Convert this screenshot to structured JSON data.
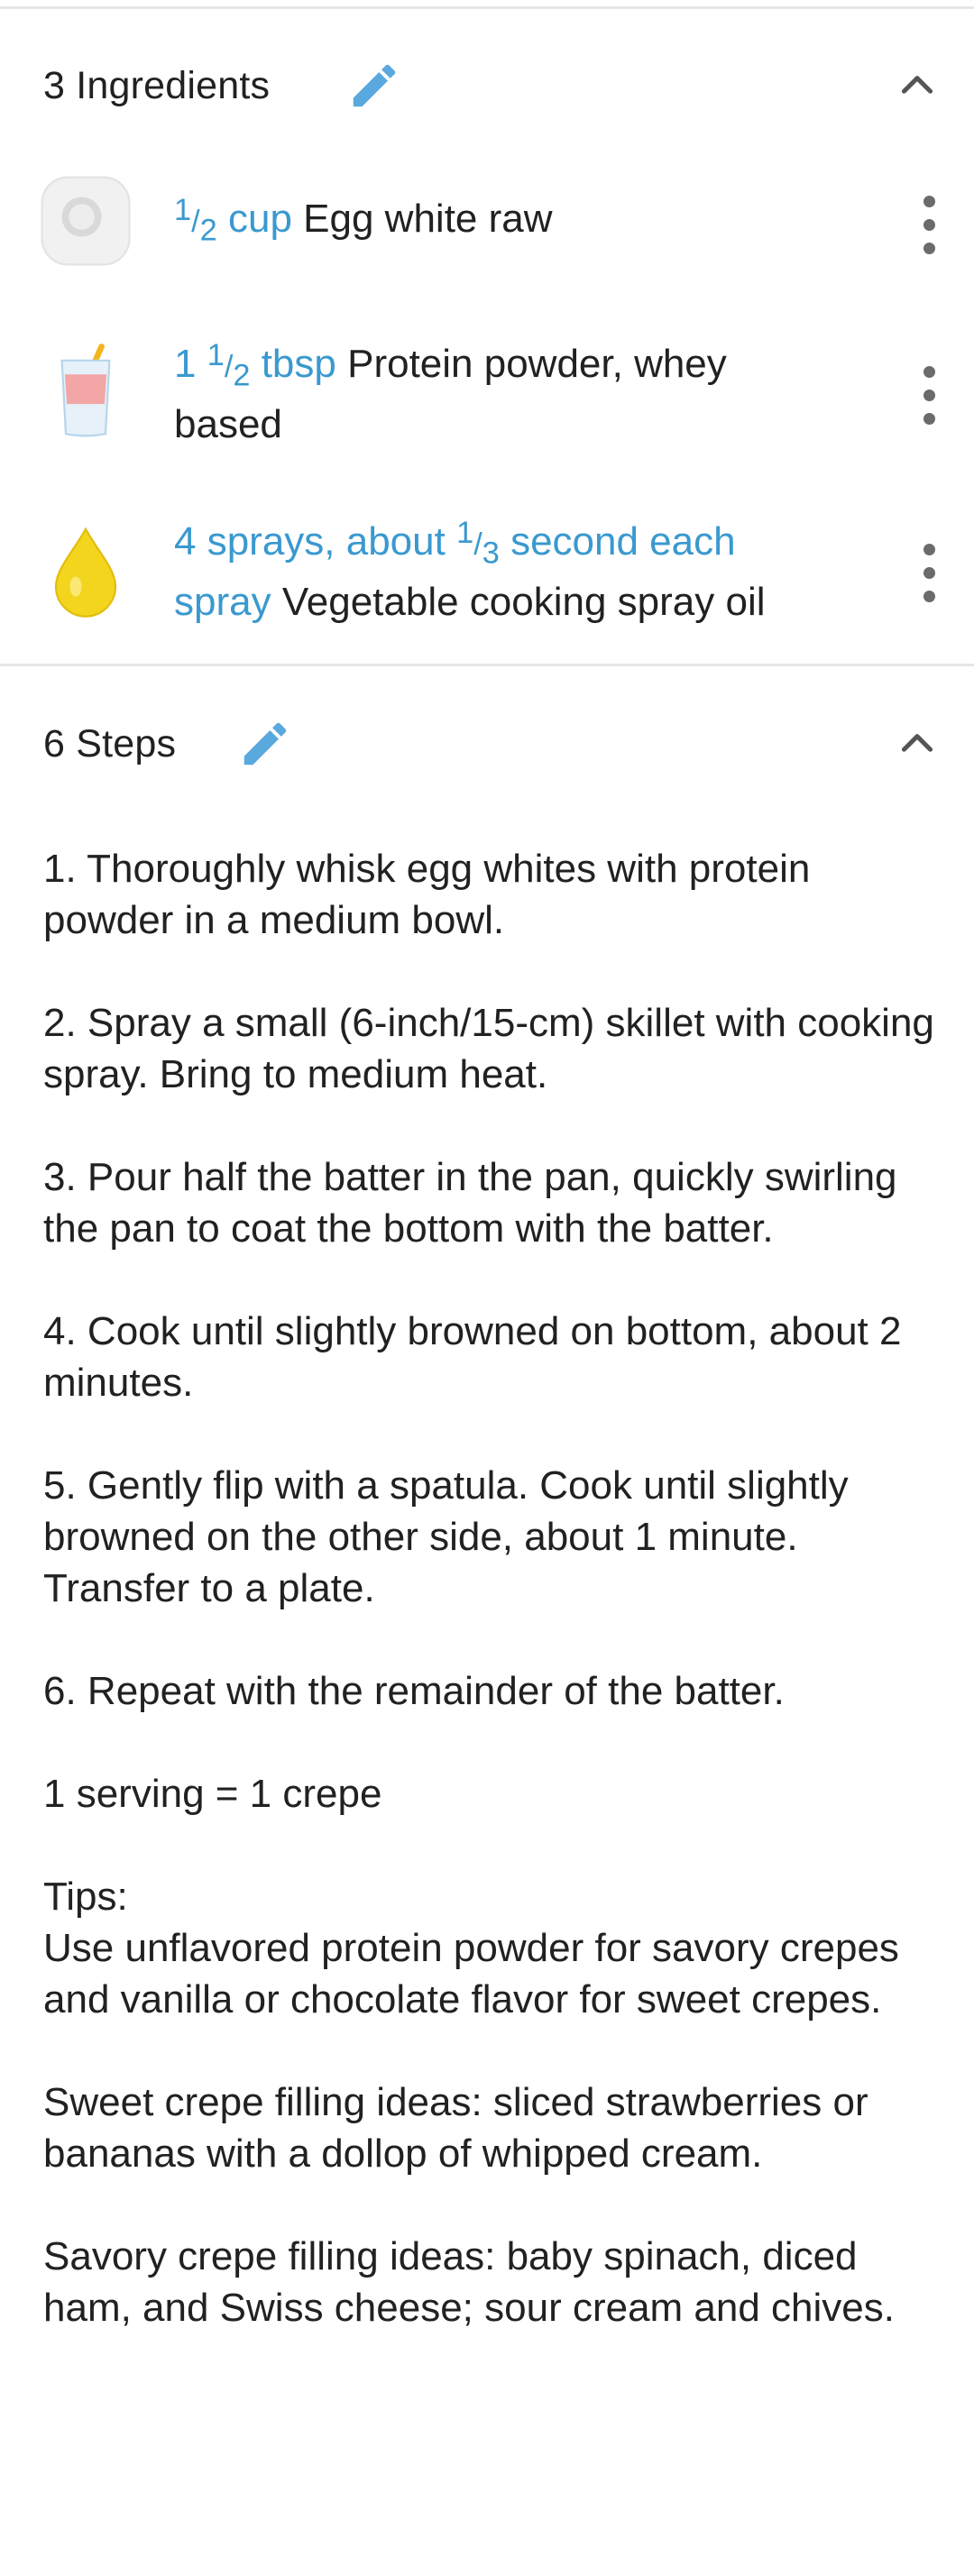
{
  "ingredients_section": {
    "title": "3 Ingredients",
    "items": [
      {
        "icon": "egg-white-icon",
        "qty_whole": "",
        "qty_num": "1",
        "qty_den": "2",
        "qty_unit": "cup",
        "name": "Egg white raw"
      },
      {
        "icon": "protein-shake-icon",
        "qty_whole": "1",
        "qty_num": "1",
        "qty_den": "2",
        "qty_unit": "tbsp",
        "name": "Protein powder, whey based"
      },
      {
        "icon": "oil-drop-icon",
        "qty_prefix": "4 sprays, about",
        "qty_num": "1",
        "qty_den": "3",
        "qty_suffix": "second each spray",
        "name": "Vegetable cooking spray oil"
      }
    ]
  },
  "steps_section": {
    "title": "6 Steps",
    "paragraphs": [
      "1. Thoroughly whisk egg whites with protein powder in a medium bowl.",
      "2. Spray a small (6-inch/15-cm) skillet with cooking spray. Bring to medium heat.",
      "3. Pour half the batter in the pan, quickly swirling the pan to coat the bottom with the batter.",
      "4. Cook until slightly browned on bottom, about 2 minutes.",
      "5. Gently flip with a spatula. Cook until slightly browned on the other side, about 1 minute. Transfer to a plate.",
      "6. Repeat with the remainder of the batter.",
      "1 serving = 1 crepe",
      "Tips:\nUse unflavored protein powder for savory crepes and vanilla or chocolate flavor for sweet crepes.",
      "Sweet crepe filling ideas: sliced strawberries or bananas with a dollop of whipped cream.",
      "Savory crepe filling ideas: baby spinach, diced ham, and Swiss cheese; sour cream and chives."
    ]
  },
  "colors": {
    "accent": "#3a99cf",
    "text": "#212121",
    "divider": "#e6e6e6",
    "icon_gray": "#6b6b6b"
  }
}
